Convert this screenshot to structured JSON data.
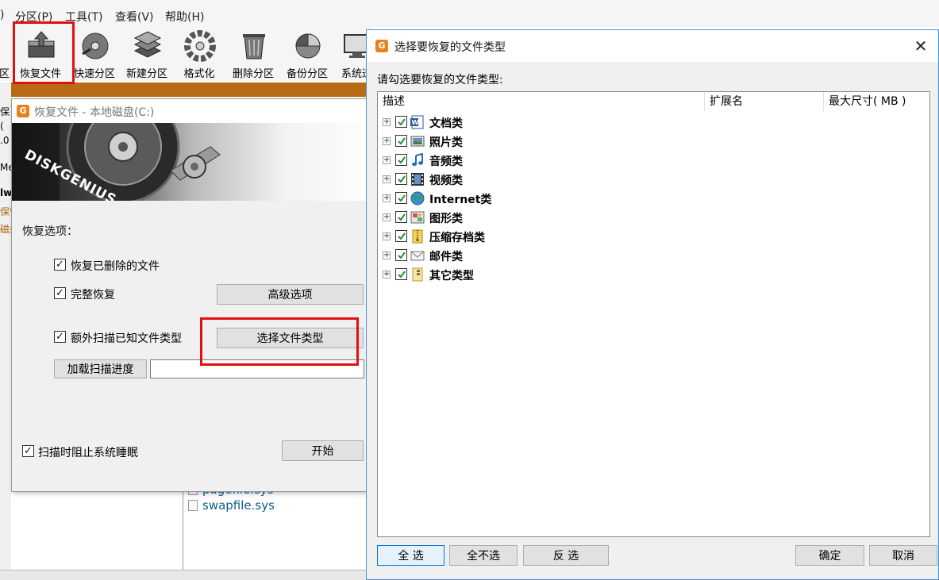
{
  "menu": {
    "items": [
      ")",
      "分区(P)",
      "工具(T)",
      "查看(V)",
      "帮助(H)"
    ]
  },
  "toolbar": {
    "items": [
      {
        "label": "区",
        "icon": "partition-icon"
      },
      {
        "label": "恢复文件",
        "icon": "recover-file-icon"
      },
      {
        "label": "快速分区",
        "icon": "quick-partition-icon"
      },
      {
        "label": "新建分区",
        "icon": "new-partition-icon"
      },
      {
        "label": "格式化",
        "icon": "format-icon"
      },
      {
        "label": "删除分区",
        "icon": "delete-partition-icon"
      },
      {
        "label": "备份分区",
        "icon": "backup-partition-icon"
      },
      {
        "label": "系统迁",
        "icon": "system-migrate-icon"
      }
    ]
  },
  "left_edge": {
    "texts": [
      "保",
      "(",
      ".0",
      "Me",
      "lw",
      "保留",
      "磁盘"
    ]
  },
  "file_panel": {
    "files": [
      "pagefile.sys",
      "swapfile.sys"
    ]
  },
  "recover_dialog": {
    "title": "恢复文件 - 本地磁盘(C:)",
    "banner_text": "DISKGENIUS",
    "section_label": "恢复选项：",
    "options": [
      {
        "label": "恢复已删除的文件",
        "checked": true
      },
      {
        "label": "完整恢复",
        "checked": true
      },
      {
        "label": "额外扫描已知文件类型",
        "checked": true
      }
    ],
    "advanced_button": "高级选项",
    "select_types_button": "选择文件类型",
    "load_progress_button": "加载扫描进度",
    "load_progress_value": "",
    "prevent_sleep": {
      "label": "扫描时阻止系统睡眠",
      "checked": true
    },
    "start_button": "开始"
  },
  "file_type_dialog": {
    "title": "选择要恢复的文件类型",
    "close_glyph": "✕",
    "prompt": "请勾选要恢复的文件类型:",
    "columns": [
      "描述",
      "扩展名",
      "最大尺寸( MB )"
    ],
    "types": [
      {
        "label": "文档类",
        "checked": true,
        "icon": "word-document-icon"
      },
      {
        "label": "照片类",
        "checked": true,
        "icon": "photo-icon"
      },
      {
        "label": "音频类",
        "checked": true,
        "icon": "music-note-icon"
      },
      {
        "label": "视频类",
        "checked": true,
        "icon": "film-icon"
      },
      {
        "label": "Internet类",
        "checked": true,
        "icon": "globe-icon"
      },
      {
        "label": "图形类",
        "checked": true,
        "icon": "graphics-icon"
      },
      {
        "label": "压缩存档类",
        "checked": true,
        "icon": "zip-archive-icon"
      },
      {
        "label": "邮件类",
        "checked": true,
        "icon": "envelope-icon"
      },
      {
        "label": "其它类型",
        "checked": true,
        "icon": "generic-file-icon"
      }
    ],
    "buttons": {
      "select_all": "全 选",
      "select_none": "全不选",
      "invert": "反 选",
      "ok": "确定",
      "cancel": "取消"
    }
  },
  "colors": {
    "highlight_red": "#e01010",
    "check_green": "#1e8e3e",
    "accent_orange": "#e8801c",
    "file_link": "#0f5e8a"
  }
}
